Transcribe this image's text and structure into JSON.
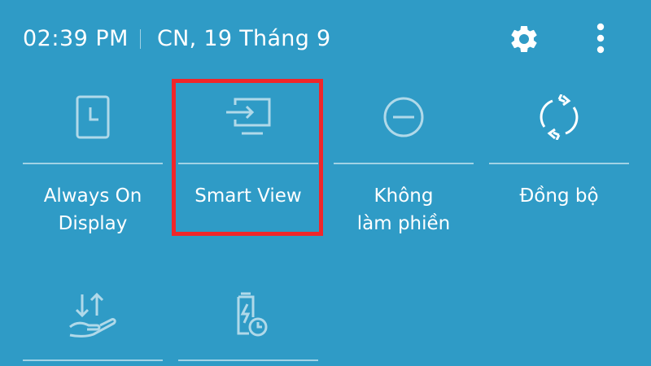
{
  "status": {
    "time": "02:39 PM",
    "date": "CN, 19 Tháng 9"
  },
  "header_icons": [
    "gear-icon",
    "more-vert-icon"
  ],
  "tiles": [
    {
      "label_line1": "Always On",
      "label_line2": "Display",
      "icon": "always-on-display-icon"
    },
    {
      "label_line1": "Smart View",
      "label_line2": "",
      "icon": "smart-view-icon"
    },
    {
      "label_line1": "Không",
      "label_line2": "làm phiền",
      "icon": "do-not-disturb-icon"
    },
    {
      "label_line1": "Đồng bộ",
      "label_line2": "",
      "icon": "sync-icon"
    }
  ],
  "tiles_row2": [
    {
      "icon": "data-transfer-hand-icon"
    },
    {
      "icon": "battery-saver-icon"
    }
  ],
  "colors": {
    "background": "#2f9bc6",
    "foreground": "#ffffff",
    "highlight": "#f0262a"
  }
}
